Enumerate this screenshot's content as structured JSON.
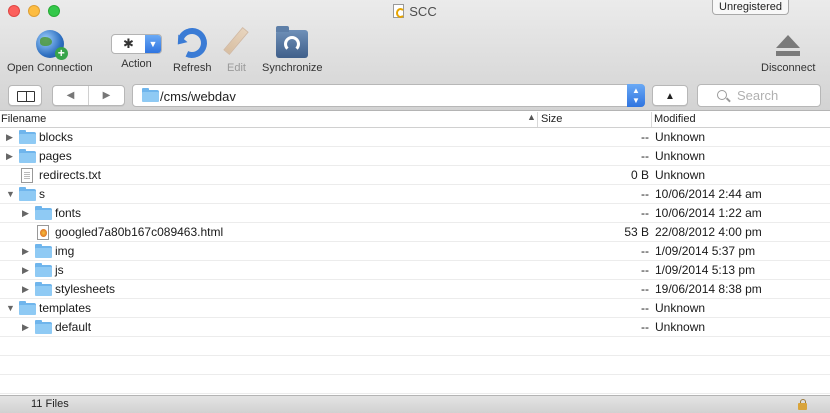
{
  "window": {
    "title": "SCC",
    "registration_badge": "Unregistered"
  },
  "toolbar": {
    "open_connection": "Open Connection",
    "action": "Action",
    "refresh": "Refresh",
    "edit": "Edit",
    "synchronize": "Synchronize",
    "disconnect": "Disconnect"
  },
  "nav": {
    "path": "/cms/webdav",
    "search_placeholder": "Search",
    "back_glyph": "◀",
    "forward_glyph": "▶",
    "up_glyph": "▲"
  },
  "columns": {
    "filename": "Filename",
    "size": "Size",
    "modified": "Modified"
  },
  "files": [
    {
      "name": "blocks",
      "kind": "folder",
      "expanded": false,
      "level": 0,
      "size": "--",
      "modified": "Unknown"
    },
    {
      "name": "pages",
      "kind": "folder",
      "expanded": false,
      "level": 0,
      "size": "--",
      "modified": "Unknown"
    },
    {
      "name": "redirects.txt",
      "kind": "file",
      "level": 0,
      "size": "0 B",
      "modified": "Unknown"
    },
    {
      "name": "s",
      "kind": "folder",
      "expanded": true,
      "level": 0,
      "size": "--",
      "modified": "10/06/2014 2:44 am"
    },
    {
      "name": "fonts",
      "kind": "folder",
      "expanded": false,
      "level": 1,
      "size": "--",
      "modified": "10/06/2014 1:22 am"
    },
    {
      "name": "googled7a80b167c089463.html",
      "kind": "html",
      "level": 1,
      "size": "53 B",
      "modified": "22/08/2012 4:00 pm"
    },
    {
      "name": "img",
      "kind": "folder",
      "expanded": false,
      "level": 1,
      "size": "--",
      "modified": "1/09/2014 5:37 pm"
    },
    {
      "name": "js",
      "kind": "folder",
      "expanded": false,
      "level": 1,
      "size": "--",
      "modified": "1/09/2014 5:13 pm"
    },
    {
      "name": "stylesheets",
      "kind": "folder",
      "expanded": false,
      "level": 1,
      "size": "--",
      "modified": "19/06/2014 8:38 pm"
    },
    {
      "name": "templates",
      "kind": "folder",
      "expanded": true,
      "level": 0,
      "size": "--",
      "modified": "Unknown"
    },
    {
      "name": "default",
      "kind": "folder",
      "expanded": false,
      "level": 1,
      "size": "--",
      "modified": "Unknown"
    }
  ],
  "status": {
    "file_count": "11 Files"
  }
}
